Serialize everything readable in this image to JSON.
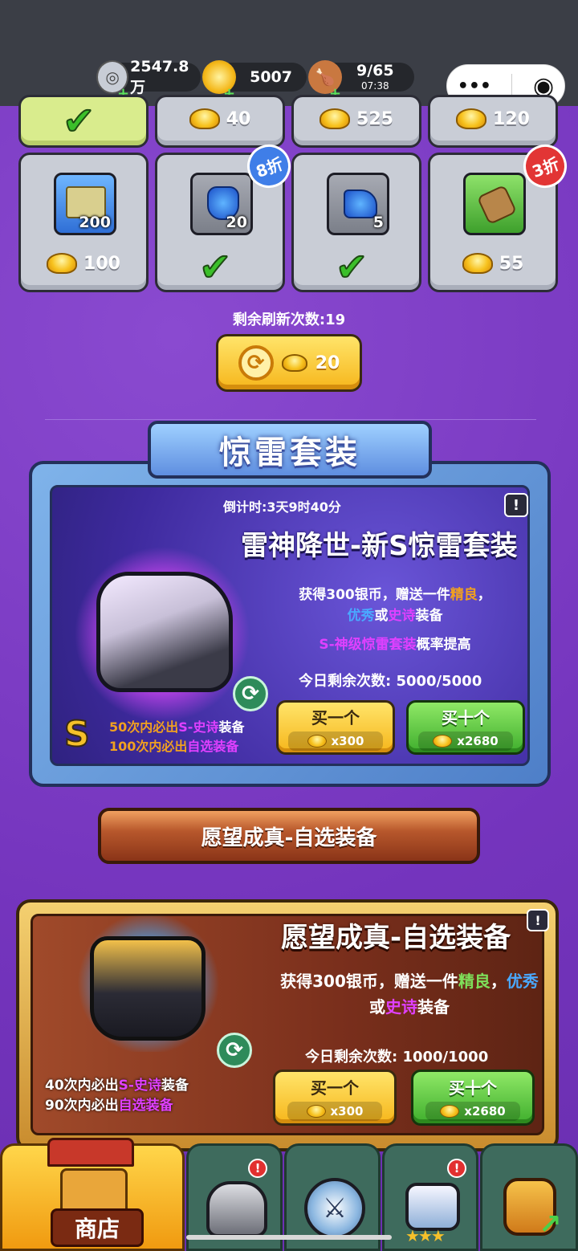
{
  "topbar": {
    "silver": "2547.8万",
    "gold": "5007",
    "stamina": "9/65",
    "stamina_timer": "07:38",
    "plus": "+",
    "menu_icon": "•••",
    "record_icon": "◉"
  },
  "grid": {
    "row1": [
      {
        "price": ""
      },
      {
        "price": "40"
      },
      {
        "price": "525"
      },
      {
        "price": "120"
      }
    ],
    "row2": [
      {
        "qty": "200",
        "price": "100",
        "icon": "map-scroll-icon"
      },
      {
        "qty": "20",
        "price": "",
        "icon": "blue-armor-icon",
        "badge": "8折"
      },
      {
        "qty": "5",
        "price": "",
        "icon": "blue-boot-icon"
      },
      {
        "qty": "",
        "price": "55",
        "icon": "bracer-icon",
        "badge": "3折"
      }
    ],
    "check": "✔"
  },
  "refresh": {
    "remaining": "剩余刷新次数:19",
    "cost": "20"
  },
  "set1": {
    "banner": "惊雷套装",
    "countdown": "倒计时:3天9时40分",
    "info": "!",
    "title": "雷神降世-新S惊雷套装",
    "desc_a": "获得300银币，赠送一件",
    "desc_b": "精良",
    "desc_c": "，",
    "desc_d": "优秀",
    "desc_e": "或",
    "desc_f": "史诗",
    "desc_g": "装备",
    "desc2_a": "S-神级惊雷套装",
    "desc2_b": "概率提高",
    "today": "今日剩余次数: 5000/5000",
    "guar1_a": "50次内必出",
    "guar1_b": "S-史诗",
    "guar1_c": "装备",
    "guar2_a": "100次内必出",
    "guar2_b": "自选装备",
    "s_mark": "S",
    "buy1": "买一个",
    "buy1_cost": "x300",
    "buy10": "买十个",
    "buy10_cost": "x2680"
  },
  "set2": {
    "banner": "愿望成真-自选装备",
    "title": "愿望成真-自选装备",
    "info": "!",
    "desc_a": "获得300银币，赠送一件",
    "desc_b": "精良",
    "desc_c": "，",
    "desc_d": "优秀",
    "desc_e": "或",
    "desc_f": "史诗",
    "desc_g": "装备",
    "today": "今日剩余次数: 1000/1000",
    "guar1_a": "40次内必出",
    "guar1_b": "S-史诗",
    "guar1_c": "装备",
    "guar2_a": "90次内必出",
    "guar2_b": "自选装备",
    "buy1": "买一个",
    "buy1_cost": "x300",
    "buy10": "买十个",
    "buy10_cost": "x2680"
  },
  "tabs": [
    {
      "label": "商店",
      "icon": "shop-icon"
    },
    {
      "label": "",
      "icon": "helmet-icon",
      "alert": "!"
    },
    {
      "label": "",
      "icon": "crossed-swords-icon"
    },
    {
      "label": "",
      "icon": "winged-star-icon",
      "alert": "!"
    },
    {
      "label": "",
      "icon": "fist-upgrade-icon"
    }
  ]
}
